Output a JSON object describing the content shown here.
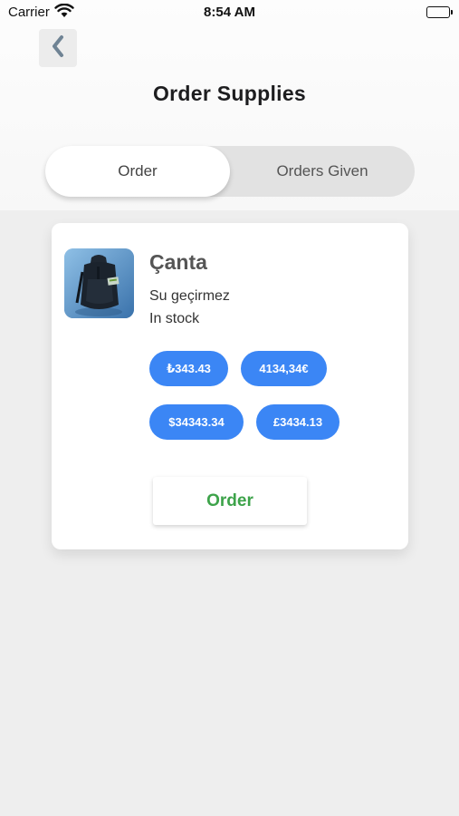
{
  "status_bar": {
    "carrier": "Carrier",
    "time": "8:54 AM"
  },
  "header": {
    "title": "Order Supplies",
    "back_icon": "chevron-left-icon"
  },
  "tabs": [
    {
      "label": "Order",
      "active": true
    },
    {
      "label": "Orders Given",
      "active": false
    }
  ],
  "product": {
    "name": "Çanta",
    "description": "Su geçirmez",
    "stock": "In stock",
    "prices": [
      "₺343.43",
      "4134,34€",
      "$34343.34",
      "£3434.13"
    ],
    "order_label": "Order"
  },
  "colors": {
    "price_pill": "#3b86f5",
    "order_text": "#3da34a",
    "background": "#eeeeee"
  }
}
